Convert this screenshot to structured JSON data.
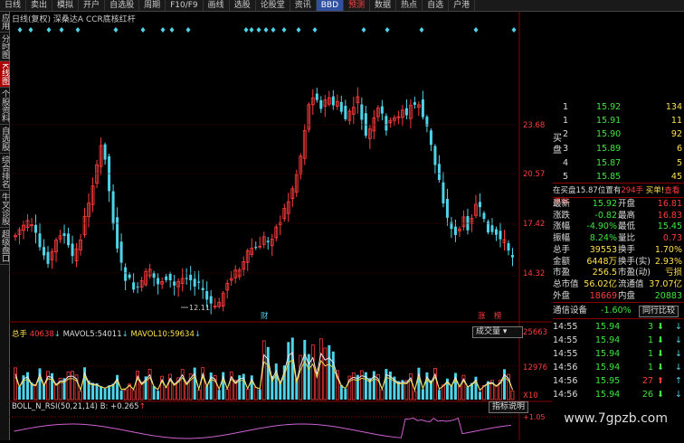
{
  "menu": [
    "日线",
    "卖出",
    "模拟",
    "开户",
    "自选股",
    "周期",
    "F10/F9",
    "画线",
    "选股",
    "论股堂",
    "资讯",
    "BBD",
    "预测",
    "数据",
    "热点",
    "自选",
    "户港"
  ],
  "left_tabs": [
    "应用",
    "分时图",
    "K线图",
    "个股资料",
    "自选股",
    "综合排名",
    "牛叉诊股",
    "超级盘口"
  ],
  "chart_header": {
    "period": "日线(复权)",
    "name": "深桑达A",
    "indicator": "CCR底核红杆"
  },
  "price_axis": [
    "23.68",
    "20.57",
    "17.42",
    "14.32"
  ],
  "low_label": "12.11",
  "event_marks": [
    "财",
    "涨",
    "榜"
  ],
  "volume_header": {
    "label": "总手",
    "value": "40638",
    "ma5_label": "MAVOL5:",
    "ma5": "54011",
    "ma10_label": "MAVOL10:",
    "ma10": "59634"
  },
  "volume_axis": [
    "25663",
    "12976",
    "X10"
  ],
  "volume_button": "成交量",
  "indicator_header": "BOLL_N_RSI(50,21,14) B: +0.265",
  "indicator_button": "指标说明",
  "indicator_axis": "+1.05",
  "orderbook": {
    "sell_label": "买盘",
    "rows": [
      {
        "n": "1",
        "price": "15.92",
        "vol": "134"
      },
      {
        "n": "1",
        "price": "15.91",
        "vol": "11"
      },
      {
        "n": "2",
        "price": "15.90",
        "vol": "92"
      },
      {
        "n": "3",
        "price": "15.89",
        "vol": "6"
      },
      {
        "n": "4",
        "price": "15.87",
        "vol": "5"
      },
      {
        "n": "5",
        "price": "15.85",
        "vol": "45"
      }
    ],
    "buy_label": "买盘"
  },
  "pending": {
    "text": "在买盘15.87位置有",
    "count": "294手",
    "action": "买单!",
    "link": "查看详细"
  },
  "quote": [
    {
      "k1": "最新",
      "v1": "15.92",
      "k2": "开盘",
      "v2": "16.81"
    },
    {
      "k1": "涨跌",
      "v1": "-0.82",
      "k2": "最高",
      "v2": "16.83"
    },
    {
      "k1": "涨幅",
      "v1": "-4.90%",
      "k2": "最低",
      "v2": "15.45"
    },
    {
      "k1": "振幅",
      "v1": "8.24%",
      "k2": "量比",
      "v2": "0.73"
    },
    {
      "k1": "总手",
      "v1": "39553",
      "k2": "换手",
      "v2": "1.70%"
    },
    {
      "k1": "金额",
      "v1": "6448万",
      "k2": "换手(实)",
      "v2": "2.93%"
    },
    {
      "k1": "市盈",
      "v1": "256.5",
      "k2": "市盈(动)",
      "v2": "亏损"
    },
    {
      "k1": "总市值",
      "v1": "56.02亿",
      "k2": "流通值",
      "v2": "37.07亿"
    },
    {
      "k1": "外盘",
      "v1": "18669",
      "k2": "内盘",
      "v2": "20883"
    }
  ],
  "sector": {
    "name": "通信设备",
    "change": "-1.60%",
    "button": "同行比较"
  },
  "ticks": [
    {
      "time": "14:55",
      "price": "15.94",
      "vol": "3",
      "dir": "down"
    },
    {
      "time": "14:55",
      "price": "15.94",
      "vol": "1",
      "dir": "down"
    },
    {
      "time": "14:55",
      "price": "15.94",
      "vol": "1",
      "dir": "down"
    },
    {
      "time": "14:56",
      "price": "15.94",
      "vol": "1",
      "dir": "down"
    },
    {
      "time": "14:56",
      "price": "15.95",
      "vol": "27",
      "dir": "up"
    },
    {
      "time": "14:56",
      "price": "15.94",
      "vol": "26",
      "dir": "down"
    }
  ],
  "watermark": "www.7gpzb.com",
  "colors": {
    "up": "#ff3c3c",
    "down": "#4fd3e8",
    "ma_white": "#e8e8e8",
    "ma_yellow": "#e6d34a",
    "ma_purple": "#d060d0"
  }
}
